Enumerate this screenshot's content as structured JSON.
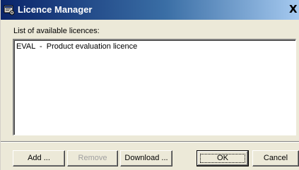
{
  "window": {
    "title": "Licence Manager",
    "close_symbol": "X"
  },
  "licences": {
    "label": "List of available licences:",
    "items": [
      "EVAL  -  Product evaluation licence"
    ]
  },
  "buttons": {
    "add": "Add ...",
    "remove": "Remove",
    "download": "Download ...",
    "ok": "OK",
    "cancel": "Cancel"
  },
  "icons": {
    "title_icon": "licence-manager-app-icon",
    "close": "close-icon"
  },
  "colors": {
    "title_gradient_start": "#0a246a",
    "title_gradient_end": "#a6caf0",
    "dialog_background": "#ece9d8",
    "disabled_text": "#a0a0a0"
  }
}
